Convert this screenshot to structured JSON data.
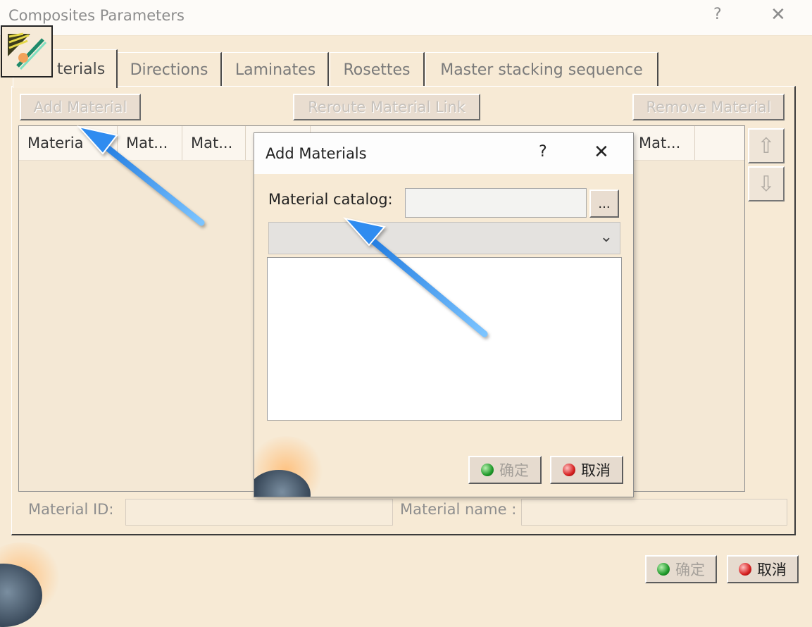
{
  "window": {
    "title": "Composites Parameters",
    "help_glyph": "?",
    "close_glyph": "✕"
  },
  "tabs": [
    {
      "label": "terials",
      "active": true
    },
    {
      "label": "Directions",
      "active": false
    },
    {
      "label": "Laminates",
      "active": false
    },
    {
      "label": "Rosettes",
      "active": false
    },
    {
      "label": "Master stacking sequence",
      "active": false
    }
  ],
  "toolbar": {
    "add_label": "Add Material",
    "reroute_label": "Reroute Material Link",
    "remove_label": "Remove Material"
  },
  "table": {
    "columns": [
      "Materia",
      "Mat...",
      "Mat...",
      "Mat..."
    ]
  },
  "side_buttons": {
    "up_glyph": "⇧",
    "down_glyph": "⇩"
  },
  "fields": {
    "material_id_label": "Material ID:",
    "material_name_label": "Material name :"
  },
  "footer": {
    "ok_label": "确定",
    "cancel_label": "取消"
  },
  "dialog": {
    "title": "Add Materials",
    "help_glyph": "?",
    "close_glyph": "✕",
    "catalog_label": "Material catalog:",
    "browse_label": "...",
    "combo_glyph": "⌄",
    "ok_label": "确定",
    "cancel_label": "取消"
  },
  "colors": {
    "background": "#f7ead5",
    "annotation_arrow": "#2f8cf0"
  }
}
